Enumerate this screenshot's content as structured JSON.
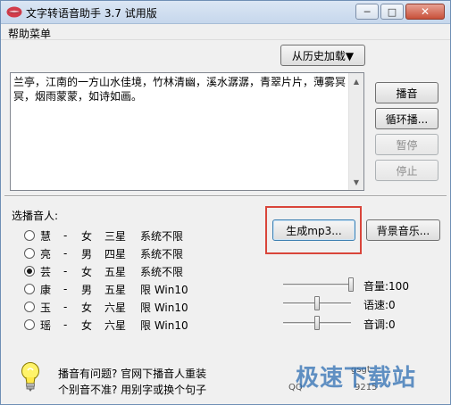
{
  "window": {
    "title": "文字转语音助手 3.7 试用版",
    "controls": {
      "minimize_glyph": "─",
      "maximize_glyph": "□",
      "close_glyph": "✕"
    }
  },
  "menu": {
    "items": [
      "帮助菜单"
    ]
  },
  "history_button": "从历史加载▼",
  "text_content": "兰亭，江南的一方山水佳境，竹林清幽，溪水潺潺，青翠片片，薄雾冥冥，烟雨蒙蒙，如诗如画。",
  "side_buttons": {
    "play": "播音",
    "loop": "循环播...",
    "pause": "暂停",
    "stop": "停止"
  },
  "voice_section": {
    "label": "选播音人:",
    "voices": [
      {
        "name": "慧",
        "sep": "-",
        "gender": "女",
        "rating": "三星",
        "system": "系统不限",
        "selected": false
      },
      {
        "name": "亮",
        "sep": "-",
        "gender": "男",
        "rating": "四星",
        "system": "系统不限",
        "selected": false
      },
      {
        "name": "芸",
        "sep": "-",
        "gender": "女",
        "rating": "五星",
        "system": "系统不限",
        "selected": true
      },
      {
        "name": "康",
        "sep": "-",
        "gender": "男",
        "rating": "五星",
        "system": "限 Win10",
        "selected": false
      },
      {
        "name": "玉",
        "sep": "-",
        "gender": "女",
        "rating": "六星",
        "system": "限 Win10",
        "selected": false
      },
      {
        "name": "瑶",
        "sep": "-",
        "gender": "女",
        "rating": "六星",
        "system": "限 Win10",
        "selected": false
      }
    ]
  },
  "generate_button": "生成mp3...",
  "bg_music_button": "背景音乐...",
  "sliders": {
    "volume": {
      "label": "音量:100",
      "value": 100,
      "max": 100
    },
    "speed": {
      "label": "语速:0",
      "value": 0,
      "min": -10,
      "max": 10
    },
    "pitch": {
      "label": "音调:0",
      "value": 0,
      "min": -10,
      "max": 10
    }
  },
  "tips": {
    "line1": "播音有问题? 官网下播音人重装",
    "line2": "个别音不准? 用别字或换个句子"
  },
  "watermark": {
    "big": "极速下载站",
    "small1": "gsgt",
    "small2": "QQ",
    "small3": "9215"
  },
  "colors": {
    "highlight": "#d9453a",
    "watermark": "#2f6fb3"
  }
}
